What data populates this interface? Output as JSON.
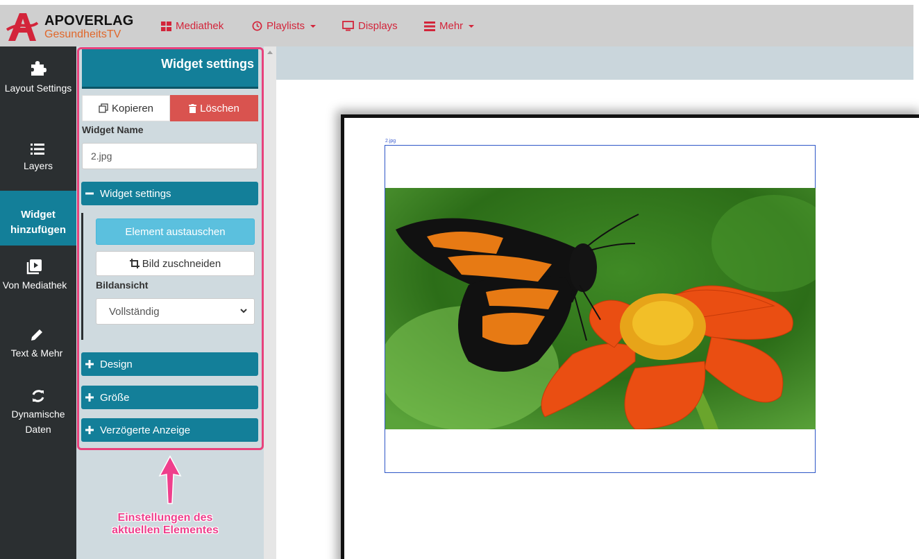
{
  "brand": {
    "name": "APOVERLAG",
    "subtitle": "GesundheitsTV",
    "colors": {
      "logo_red": "#d3243a",
      "subtitle_orange": "#e0672a"
    }
  },
  "topnav": {
    "items": [
      {
        "label": "Mediathek",
        "icon": "grid-icon",
        "dropdown": false
      },
      {
        "label": "Playlists",
        "icon": "clock-icon",
        "dropdown": true
      },
      {
        "label": "Displays",
        "icon": "monitor-icon",
        "dropdown": false
      },
      {
        "label": "Mehr",
        "icon": "list-icon",
        "dropdown": true
      }
    ],
    "color": "#d3243a"
  },
  "sidebar": {
    "items": [
      {
        "label": "Layout Settings",
        "icon": "puzzle-icon"
      },
      {
        "label": "Layers",
        "icon": "layers-list-icon"
      },
      {
        "label": "Widget hinzufügen",
        "icon": "",
        "active": true
      },
      {
        "label": "Von Mediathek",
        "icon": "media-library-icon"
      },
      {
        "label": "Text & Mehr",
        "icon": "pencil-icon"
      },
      {
        "label": "Dynamische Daten",
        "icon": "refresh-icon"
      }
    ],
    "colors": {
      "background": "#2b2f31",
      "active": "#137f99"
    }
  },
  "panel": {
    "title": "Widget settings",
    "copy_label": "Kopieren",
    "delete_label": "Löschen",
    "widget_name_label": "Widget Name",
    "widget_name_value": "2.jpg",
    "sections": {
      "widget_settings": {
        "label": "Widget settings",
        "expanded": true
      },
      "design": {
        "label": "Design",
        "expanded": false
      },
      "groesse": {
        "label": "Größe",
        "expanded": false
      },
      "verzoegert": {
        "label": "Verzögerte Anzeige",
        "expanded": false
      }
    },
    "exchange_label": "Element austauschen",
    "crop_label": "Bild zuschneiden",
    "bildansicht_label": "Bildansicht",
    "bildansicht_value": "Vollständig",
    "colors": {
      "accent": "#137f99",
      "danger": "#d9534f",
      "info": "#5bc0de"
    }
  },
  "annotation": {
    "text": "Einstellungen des aktuellen Elementes",
    "color": "#ef3f8c"
  },
  "canvas": {
    "widget_tag": "2.jpg",
    "image_description_icon": "butterfly-photo"
  }
}
